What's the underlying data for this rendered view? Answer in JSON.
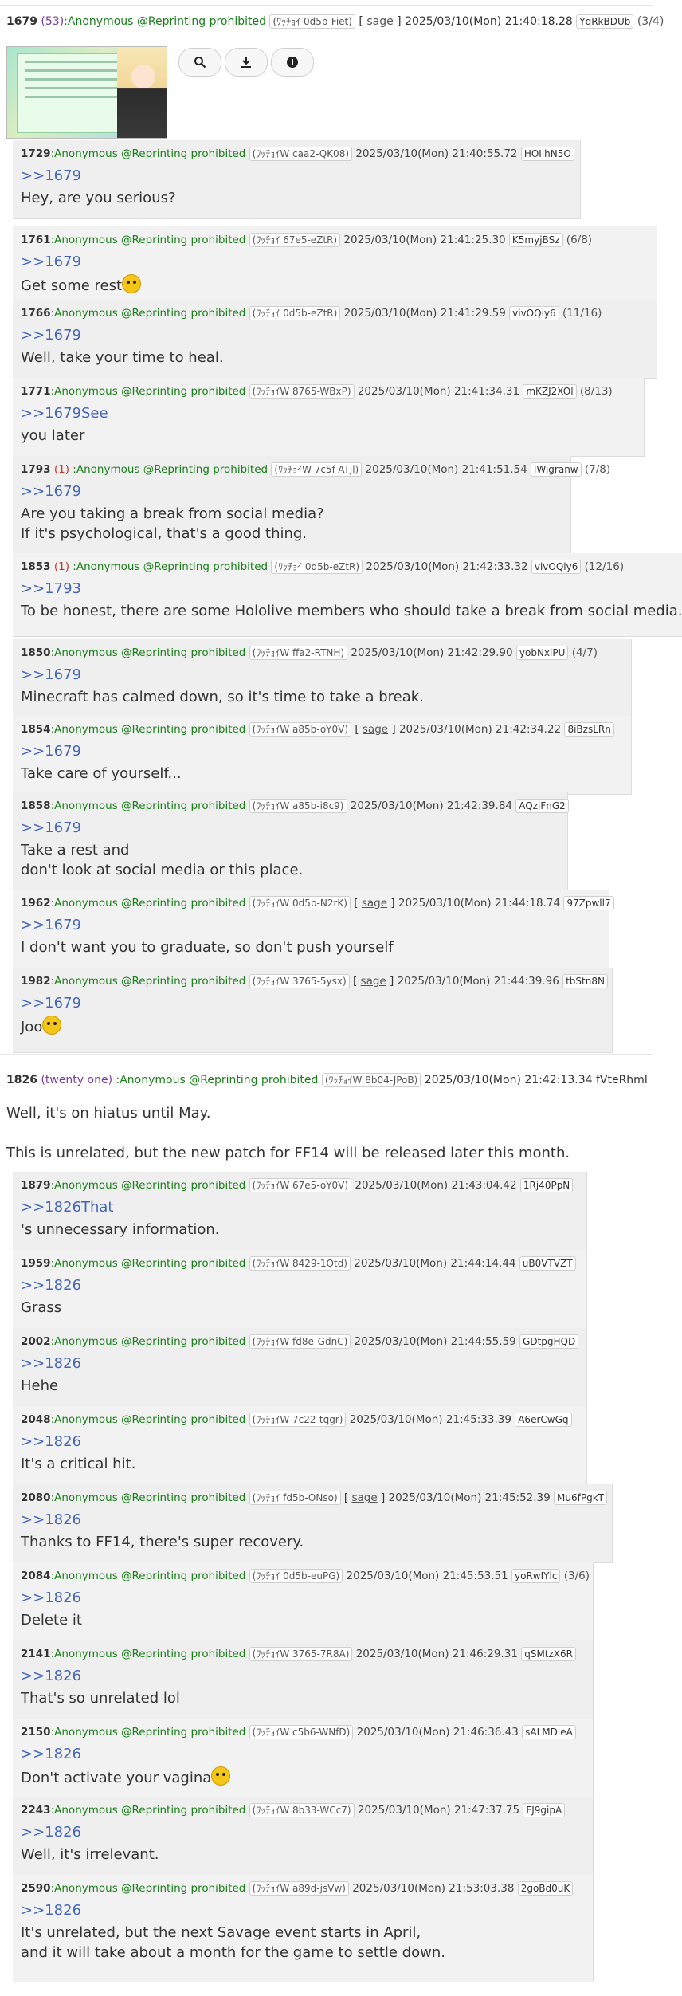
{
  "thread1": {
    "op": {
      "number": "1679",
      "count": "(53)",
      "name": ":Anonymous @Reprinting prohibited",
      "id": "(ﾜｯﾁｮｲ 0d5b-Fiet)",
      "sage": "sage",
      "date": "2025/03/10(Mon) 21:40:18.28",
      "hash": "YqRkBDUb",
      "idcount": "(3/4)"
    },
    "buttons": [
      "search-icon",
      "download-icon",
      "info-icon"
    ],
    "replies": [
      {
        "num": "1729",
        "resc": "",
        "name": "Anonymous @Reprinting prohibited",
        "id": "(ﾜｯﾁｮｲW caa2-QK08)",
        "sage": "",
        "date": "2025/03/10(Mon) 21:40:55.72",
        "hash": "HOIlhN5O",
        "idcount": "",
        "quote": ">>1679",
        "lines": [
          "Hey, are you serious?"
        ]
      },
      {
        "num": "1761",
        "resc": "",
        "name": "Anonymous @Reprinting prohibited",
        "id": "(ﾜｯﾁｮｲ 67e5-eZtR)",
        "sage": "",
        "date": "2025/03/10(Mon) 21:41:25.30",
        "hash": "K5myjBSz",
        "idcount": "(6/8)",
        "quote": ">>1679",
        "lines": [
          "Get some rest"
        ]
      },
      {
        "num": "1766",
        "resc": "",
        "name": "Anonymous @Reprinting prohibited",
        "id": "(ﾜｯﾁｮｲ 0d5b-eZtR)",
        "sage": "",
        "date": "2025/03/10(Mon) 21:41:29.59",
        "hash": "vivOQiy6",
        "idcount": "(11/16)",
        "quote": ">>1679",
        "lines": [
          "Well, take your time to heal."
        ]
      },
      {
        "num": "1771",
        "resc": "",
        "name": "Anonymous @Reprinting prohibited",
        "id": "(ﾜｯﾁｮｲW 8765-WBxP)",
        "sage": "",
        "date": "2025/03/10(Mon) 21:41:34.31",
        "hash": "mKZJ2XOl",
        "idcount": "(8/13)",
        "quote": ">>1679See",
        "lines": [
          "you later"
        ]
      },
      {
        "num": "1793",
        "resc": "(1)",
        "name": "Anonymous @Reprinting prohibited",
        "id": "(ﾜｯﾁｮｲW 7c5f-ATjl)",
        "sage": "",
        "date": "2025/03/10(Mon) 21:41:51.54",
        "hash": "lWigranw",
        "idcount": "(7/8)",
        "quote": ">>1679",
        "lines": [
          "Are you taking a break from social media?",
          "If it's psychological, that's a good thing."
        ]
      },
      {
        "num": "1853",
        "resc": "(1)",
        "name": "Anonymous @Reprinting prohibited",
        "id": "(ﾜｯﾁｮｲ 0d5b-eZtR)",
        "sage": "",
        "date": "2025/03/10(Mon) 21:42:33.32",
        "hash": "vivOQiy6",
        "idcount": "(12/16)",
        "quote": ">>1793",
        "lines": [
          "To be honest, there are some Hololive members who should take a break from social media."
        ]
      },
      {
        "num": "1850",
        "resc": "",
        "name": "Anonymous @Reprinting prohibited",
        "id": "(ﾜｯﾁｮｲW ffa2-RTNH)",
        "sage": "",
        "date": "2025/03/10(Mon) 21:42:29.90",
        "hash": "yobNxlPU",
        "idcount": "(4/7)",
        "quote": ">>1679",
        "lines": [
          "Minecraft has calmed down, so it's time to take a break."
        ]
      },
      {
        "num": "1854",
        "resc": "",
        "name": "Anonymous @Reprinting prohibited",
        "id": "(ﾜｯﾁｮｲW a85b-oY0V)",
        "sage": "sage",
        "date": "2025/03/10(Mon) 21:42:34.22",
        "hash": "8iBzsLRn",
        "idcount": "",
        "quote": ">>1679",
        "lines": [
          "Take care of yourself..."
        ]
      },
      {
        "num": "1858",
        "resc": "",
        "name": "Anonymous @Reprinting prohibited",
        "id": "(ﾜｯﾁｮｲW a85b-i8c9)",
        "sage": "",
        "date": "2025/03/10(Mon) 21:42:39.84",
        "hash": "AQziFnG2",
        "idcount": "",
        "quote": ">>1679",
        "lines": [
          "Take a rest and",
          "don't look at social media or this place."
        ]
      },
      {
        "num": "1962",
        "resc": "",
        "name": "Anonymous @Reprinting prohibited",
        "id": "(ﾜｯﾁｮｲW 0d5b-N2rK)",
        "sage": "sage",
        "date": "2025/03/10(Mon) 21:44:18.74",
        "hash": "97Zpwll7",
        "idcount": "",
        "quote": ">>1679",
        "lines": [
          "I don't want you to graduate, so don't push yourself"
        ]
      },
      {
        "num": "1982",
        "resc": "",
        "name": "Anonymous @Reprinting prohibited",
        "id": "(ﾜｯﾁｮｲW 3765-5ysx)",
        "sage": "sage",
        "date": "2025/03/10(Mon) 21:44:39.96",
        "hash": "tbStn8N",
        "idcount": "",
        "quote": ">>1679",
        "lines": [
          "Joo"
        ]
      }
    ]
  },
  "thread2": {
    "op": {
      "number": "1826",
      "count": "(twenty one)",
      "name": ":Anonymous @Reprinting prohibited",
      "id": "(ﾜｯﾁｮｲW 8b04-JPoB)",
      "date": "2025/03/10(Mon) 21:42:13.34",
      "hash": "fVteRhml",
      "lines": [
        "Well, it's on hiatus until May.",
        "This is unrelated, but the new patch for FF14 will be released later this month."
      ]
    },
    "replies": [
      {
        "num": "1879",
        "resc": "",
        "name": "Anonymous @Reprinting prohibited",
        "id": "(ﾜｯﾁｮｲW 67e5-oY0V)",
        "sage": "",
        "date": "2025/03/10(Mon) 21:43:04.42",
        "hash": "1Rj40PpN",
        "idcount": "",
        "quote": ">>1826That",
        "lines": [
          "'s unnecessary information."
        ]
      },
      {
        "num": "1959",
        "resc": "",
        "name": "Anonymous @Reprinting prohibited",
        "id": "(ﾜｯﾁｮｲW 8429-1Otd)",
        "sage": "",
        "date": "2025/03/10(Mon) 21:44:14.44",
        "hash": "uB0VTVZT",
        "idcount": "",
        "quote": ">>1826",
        "lines": [
          "Grass"
        ]
      },
      {
        "num": "2002",
        "resc": "",
        "name": "Anonymous @Reprinting prohibited",
        "id": "(ﾜｯﾁｮｲW fd8e-GdnC)",
        "sage": "",
        "date": "2025/03/10(Mon) 21:44:55.59",
        "hash": "GDtpgHQD",
        "idcount": "",
        "quote": ">>1826",
        "lines": [
          "Hehe"
        ]
      },
      {
        "num": "2048",
        "resc": "",
        "name": "Anonymous @Reprinting prohibited",
        "id": "(ﾜｯﾁｮｲW 7c22-tqgr)",
        "sage": "",
        "date": "2025/03/10(Mon) 21:45:33.39",
        "hash": "A6erCwGq",
        "idcount": "",
        "quote": ">>1826",
        "lines": [
          "It's a critical hit."
        ]
      },
      {
        "num": "2080",
        "resc": "",
        "name": "Anonymous @Reprinting prohibited",
        "id": "(ﾜｯﾁｮｲ fd5b-ONso)",
        "sage": "sage",
        "date": "2025/03/10(Mon) 21:45:52.39",
        "hash": "Mu6fPgkT",
        "idcount": "",
        "quote": ">>1826",
        "lines": [
          "Thanks to FF14, there's super recovery."
        ]
      },
      {
        "num": "2084",
        "resc": "",
        "name": "Anonymous @Reprinting prohibited",
        "id": "(ﾜｯﾁｮｲ 0d5b-euPG)",
        "sage": "",
        "date": "2025/03/10(Mon) 21:45:53.51",
        "hash": "yoRwIYlc",
        "idcount": "(3/6)",
        "quote": ">>1826",
        "lines": [
          "Delete it"
        ]
      },
      {
        "num": "2141",
        "resc": "",
        "name": "Anonymous @Reprinting prohibited",
        "id": "(ﾜｯﾁｮｲW 3765-7R8A)",
        "sage": "",
        "date": "2025/03/10(Mon) 21:46:29.31",
        "hash": "qSMtzX6R",
        "idcount": "",
        "quote": ">>1826",
        "lines": [
          "That's so unrelated lol"
        ]
      },
      {
        "num": "2150",
        "resc": "",
        "name": "Anonymous @Reprinting prohibited",
        "id": "(ﾜｯﾁｮｲW c5b6-WNfD)",
        "sage": "",
        "date": "2025/03/10(Mon) 21:46:36.43",
        "hash": "sALMDieA",
        "idcount": "",
        "quote": ">>1826",
        "lines": [
          "Don't activate your vagina"
        ]
      },
      {
        "num": "2243",
        "resc": "",
        "name": "Anonymous @Reprinting prohibited",
        "id": "(ﾜｯﾁｮｲW 8b33-WCc7)",
        "sage": "",
        "date": "2025/03/10(Mon) 21:47:37.75",
        "hash": "FJ9gipA",
        "idcount": "",
        "quote": ">>1826",
        "lines": [
          "Well, it's irrelevant."
        ]
      },
      {
        "num": "2590",
        "resc": "",
        "name": "Anonymous @Reprinting prohibited",
        "id": "(ﾜｯﾁｮｲW a89d-jsVw)",
        "sage": "",
        "date": "2025/03/10(Mon) 21:53:03.38",
        "hash": "2goBd0uK",
        "idcount": "",
        "quote": ">>1826",
        "lines": [
          "It's unrelated, but the next Savage event starts in April,",
          "and it will take about a month for the game to settle down."
        ]
      }
    ]
  }
}
